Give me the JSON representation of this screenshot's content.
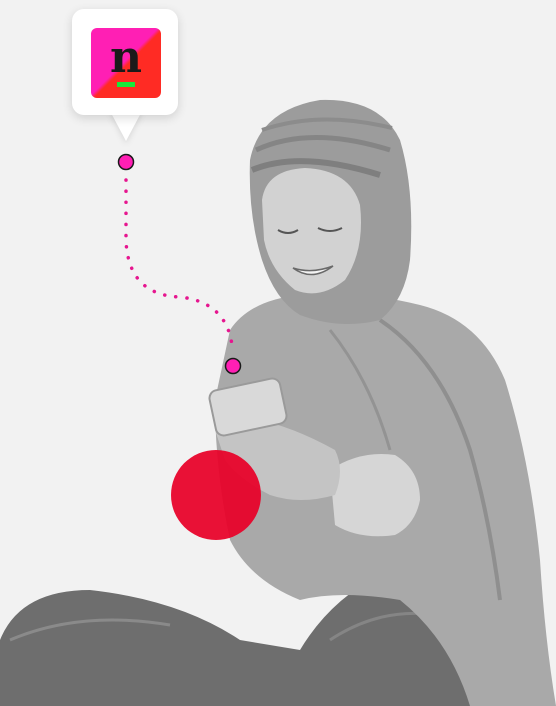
{
  "app_icon": {
    "glyph": "n",
    "icon": "app-logo-icon",
    "colors": {
      "top": "#ff1fb4",
      "bottom": "#ff2b24",
      "underline": "#17e83a",
      "glyph": "#1a1a1a"
    }
  },
  "connector": {
    "dot_color": "#e6168f",
    "style": "dotted"
  },
  "photo": {
    "subject": "person-using-smartphone",
    "tone": "grayscale"
  },
  "accent": {
    "color": "#e80028"
  }
}
